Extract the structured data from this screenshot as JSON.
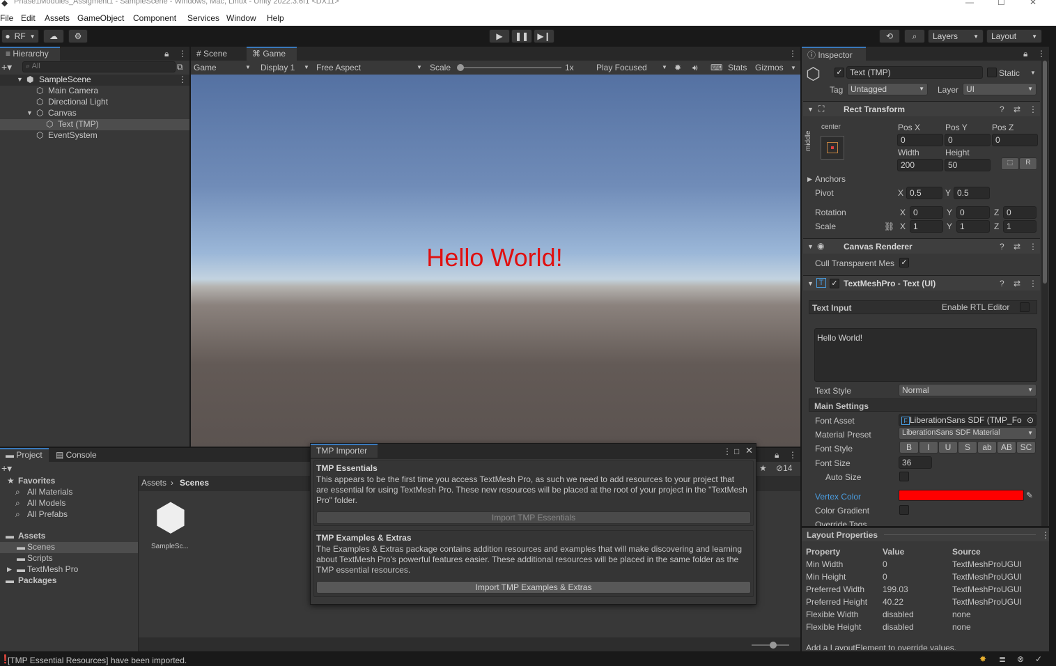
{
  "window": {
    "title": "Phase1Modules_Assigment1 - SampleScene - Windows, Mac, Linux - Unity 2022.3.6f1 <DX11>",
    "controls": [
      "—",
      "☐",
      "✕"
    ]
  },
  "menu": [
    "File",
    "Edit",
    "Assets",
    "GameObject",
    "Component",
    "Services",
    "Window",
    "Help"
  ],
  "toolbar": {
    "account": "RF",
    "layers": "Layers",
    "layout": "Layout"
  },
  "hierarchy": {
    "tab": "Hierarchy",
    "search_placeholder": "All",
    "scene": "SampleScene",
    "items": [
      "Main Camera",
      "Directional Light",
      "Canvas",
      "Text (TMP)",
      "EventSystem"
    ]
  },
  "game_view": {
    "tabs": [
      "Scene",
      "Game"
    ],
    "mode": "Game",
    "display": "Display 1",
    "aspect": "Free Aspect",
    "scale_label": "Scale",
    "scale_value": "1x",
    "play_mode": "Play Focused",
    "stats": "Stats",
    "gizmos": "Gizmos",
    "content_text": "Hello World!",
    "text_color": "#e01010"
  },
  "project": {
    "tabs": [
      "Project",
      "Console"
    ],
    "favorites_label": "Favorites",
    "favorites": [
      "All Materials",
      "All Models",
      "All Prefabs"
    ],
    "assets_label": "Assets",
    "assets": [
      "Scenes",
      "Scripts",
      "TextMesh Pro"
    ],
    "packages_label": "Packages",
    "breadcrumb": [
      "Assets",
      "Scenes"
    ],
    "file_name": "SampleSc...",
    "hidden_count": "14"
  },
  "tmp_importer": {
    "title": "TMP Importer",
    "essentials_title": "TMP Essentials",
    "essentials_desc": "This appears to be the first time you access TextMesh Pro, as such we need to add resources to your project that are essential for using TextMesh Pro. These new resources will be placed at the root of your project in the \"TextMesh Pro\" folder.",
    "essentials_button": "Import TMP Essentials",
    "extras_title": "TMP Examples & Extras",
    "extras_desc": "The Examples & Extras package contains addition resources and examples that will make discovering and learning about TextMesh Pro's powerful features easier. These additional resources will be placed in the same folder as the TMP essential resources.",
    "extras_button": "Import TMP Examples & Extras"
  },
  "inspector": {
    "tab": "Inspector",
    "object_name": "Text (TMP)",
    "static_label": "Static",
    "tag_label": "Tag",
    "tag_value": "Untagged",
    "layer_label": "Layer",
    "layer_value": "UI",
    "rect_transform": {
      "title": "Rect Transform",
      "anchor_h": "center",
      "anchor_v": "middle",
      "pos_x_label": "Pos X",
      "pos_y_label": "Pos Y",
      "pos_z_label": "Pos Z",
      "pos_x": "0",
      "pos_y": "0",
      "pos_z": "0",
      "width_label": "Width",
      "height_label": "Height",
      "width": "200",
      "height": "50",
      "anchors_label": "Anchors",
      "pivot_label": "Pivot",
      "pivot_x": "0.5",
      "pivot_y": "0.5",
      "rotation_label": "Rotation",
      "rot_x": "0",
      "rot_y": "0",
      "rot_z": "0",
      "scale_label": "Scale",
      "scale_x": "1",
      "scale_y": "1",
      "scale_z": "1",
      "x": "X",
      "y": "Y",
      "z": "Z",
      "r": "R"
    },
    "canvas_renderer": {
      "title": "Canvas Renderer",
      "cull_label": "Cull Transparent Mes"
    },
    "tmp_text": {
      "title": "TextMeshPro - Text (UI)",
      "text_input_label": "Text Input",
      "rtl_label": "Enable RTL Editor",
      "text_value": "Hello World!",
      "text_style_label": "Text Style",
      "text_style_value": "Normal",
      "main_settings": "Main Settings",
      "font_asset_label": "Font Asset",
      "font_asset_value": "LiberationSans SDF (TMP_Fo",
      "material_preset_label": "Material Preset",
      "material_preset_value": "LiberationSans SDF Material",
      "font_style_label": "Font Style",
      "font_style_buttons": [
        "B",
        "I",
        "U",
        "S",
        "ab",
        "AB",
        "SC"
      ],
      "font_size_label": "Font Size",
      "font_size_value": "36",
      "auto_size_label": "Auto Size",
      "vertex_color_label": "Vertex Color",
      "vertex_color_value": "#ff0000",
      "color_gradient_label": "Color Gradient",
      "override_tags_label": "Override Tags"
    }
  },
  "layout_properties": {
    "title": "Layout Properties",
    "headers": [
      "Property",
      "Value",
      "Source"
    ],
    "rows": [
      [
        "Min Width",
        "0",
        "TextMeshProUGUI"
      ],
      [
        "Min Height",
        "0",
        "TextMeshProUGUI"
      ],
      [
        "Preferred Width",
        "199.03",
        "TextMeshProUGUI"
      ],
      [
        "Preferred Height",
        "40.22",
        "TextMeshProUGUI"
      ],
      [
        "Flexible Width",
        "disabled",
        "none"
      ],
      [
        "Flexible Height",
        "disabled",
        "none"
      ]
    ],
    "footer": "Add a LayoutElement to override values."
  },
  "status_bar": {
    "message": "[TMP Essential Resources] have been imported."
  }
}
